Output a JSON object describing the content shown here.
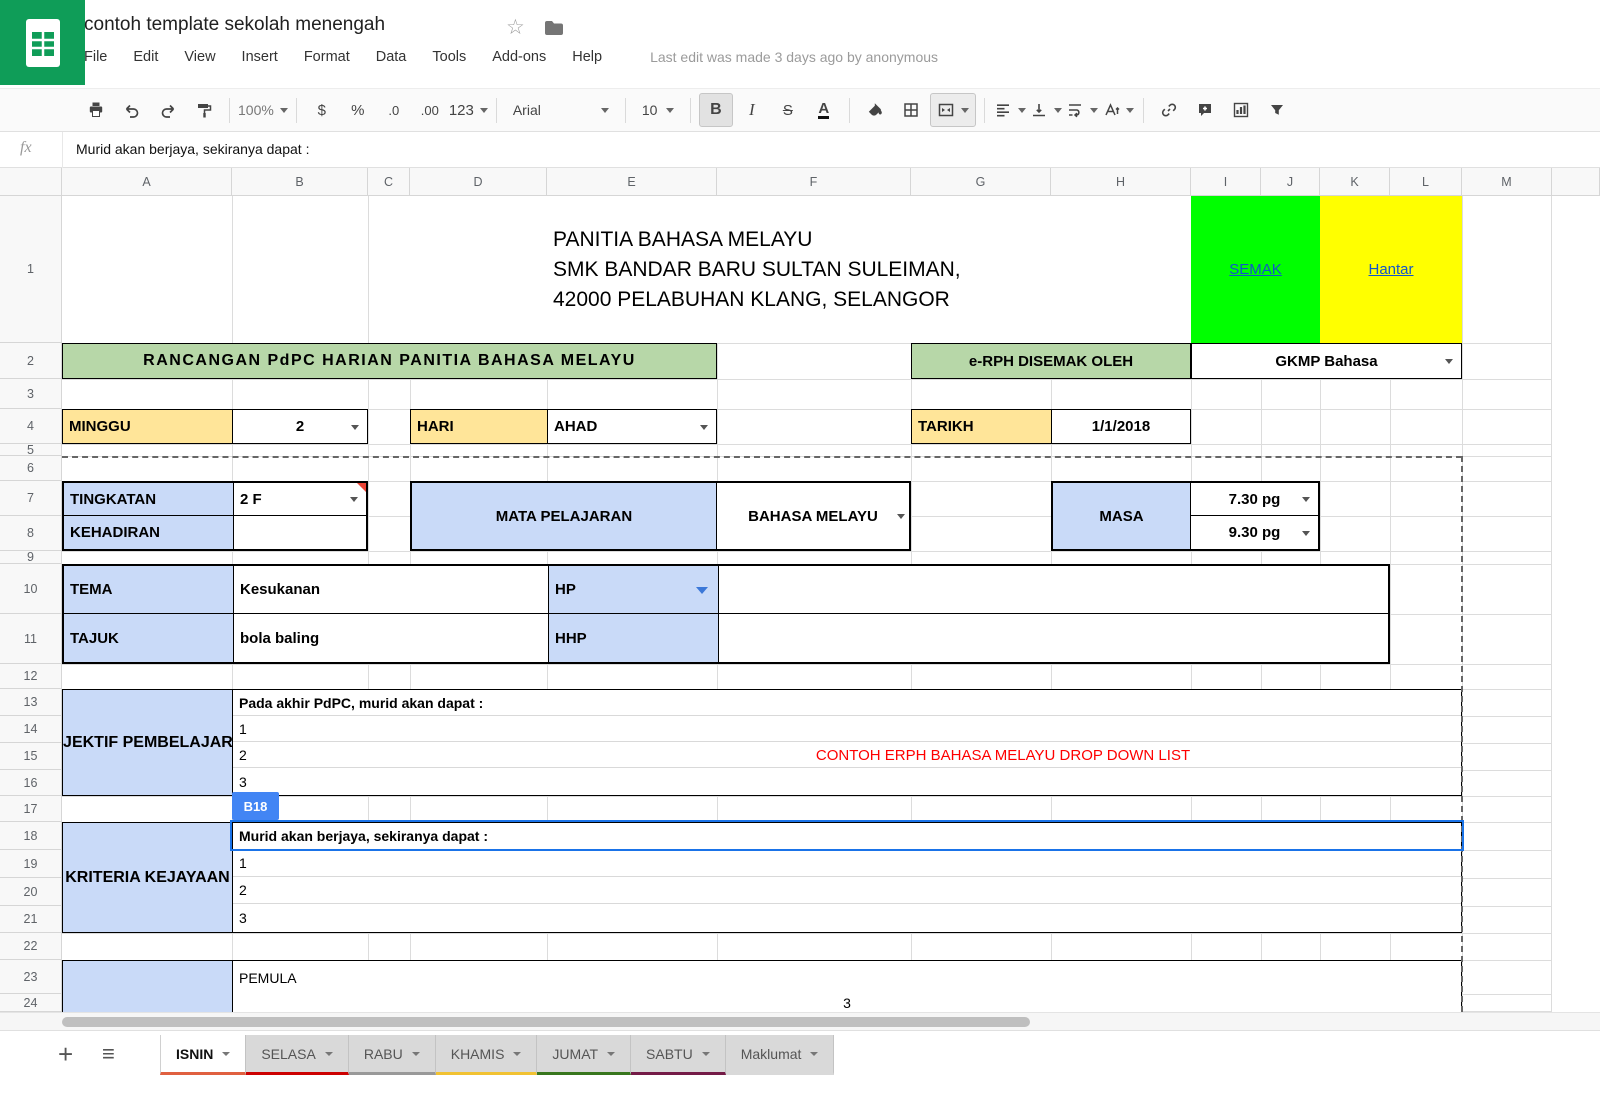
{
  "colors": {
    "logo-green": "#0f9d58",
    "green-fill": "#b7d7a8",
    "blue-fill": "#c9daf8",
    "orange-fill": "#ffe599",
    "semak-bg": "#00ff00",
    "hantar-bg": "#ffff00",
    "link-blue": "#1155cc",
    "selection-blue": "#1a73e8",
    "badge-blue": "#4285f4",
    "note-red": "#ff0000"
  },
  "header": {
    "title": "contoh template sekolah menengah",
    "menus": [
      "File",
      "Edit",
      "View",
      "Insert",
      "Format",
      "Data",
      "Tools",
      "Add-ons",
      "Help"
    ],
    "last_edit": "Last edit was made 3 days ago by anonymous"
  },
  "toolbar": {
    "zoom": "100%",
    "currency": "$",
    "percent": "%",
    "decimal_decrease": ".0",
    "decimal_increase": ".00",
    "more_formats": "123",
    "font_family": "Arial",
    "font_size": "10",
    "bold": "B",
    "italic": "I",
    "strikethrough": "S",
    "text_color": "A"
  },
  "formula_bar": {
    "fx": "fx",
    "value": "Murid akan berjaya, sekiranya dapat :"
  },
  "grid": {
    "columns": [
      "A",
      "B",
      "C",
      "D",
      "E",
      "F",
      "G",
      "H",
      "I",
      "J",
      "K",
      "L",
      "M"
    ],
    "rows": [
      "1",
      "2",
      "3",
      "4",
      "5",
      "6",
      "7",
      "8",
      "9",
      "10",
      "11",
      "12",
      "13",
      "14",
      "15",
      "16",
      "17",
      "18",
      "19",
      "20",
      "21",
      "22",
      "23",
      "24"
    ],
    "selected_cell": "B18"
  },
  "cells": {
    "school_line1": "PANITIA BAHASA MELAYU",
    "school_line2": "SMK BANDAR BARU SULTAN SULEIMAN,",
    "school_line3": "42000 PELABUHAN KLANG, SELANGOR",
    "semak": "SEMAK",
    "hantar": "Hantar",
    "rancangan": "RANCANGAN PdPC HARIAN PANITIA BAHASA MELAYU",
    "erph": "e-RPH DISEMAK OLEH",
    "gkmp": "GKMP Bahasa",
    "minggu": "MINGGU",
    "minggu_value": "2",
    "hari": "HARI",
    "hari_value": "AHAD",
    "tarikh": "TARIKH",
    "tarikh_value": "1/1/2018",
    "tingkatan": "TINGKATAN",
    "tingkatan_value": "2 F",
    "kehadiran": "KEHADIRAN",
    "mata_pelajaran": "MATA PELAJARAN",
    "mata_pelajaran_value": "BAHASA MELAYU",
    "masa": "MASA",
    "masa_mula": "7.30 pg",
    "masa_tamat": "9.30 pg",
    "tema": "TEMA",
    "tema_value": "Kesukanan",
    "hp": "HP",
    "hhp": "HHP",
    "tajuk": "TAJUK",
    "tajuk_value": "bola baling",
    "objektif": "OBJEKTIF PEMBELAJARAN",
    "objektif_intro": "Pada akhir PdPC, murid akan dapat :",
    "item1": "1",
    "item2": "2",
    "item3": "3",
    "note": "CONTOH ERPH BAHASA MELAYU DROP DOWN LIST",
    "kriteria": "KRITERIA KEJAYAAN",
    "kriteria_intro": "Murid akan berjaya, sekiranya dapat :",
    "pemula": "PEMULA",
    "row24": "3"
  },
  "sheet_tabs": [
    {
      "label": "ISNIN",
      "color": "#e06040",
      "active": true
    },
    {
      "label": "SELASA",
      "color": "#cc0000",
      "active": false
    },
    {
      "label": "RABU",
      "color": "#999999",
      "active": false
    },
    {
      "label": "KHAMIS",
      "color": "#f1c232",
      "active": false
    },
    {
      "label": "JUMAT",
      "color": "#38761d",
      "active": false
    },
    {
      "label": "SABTU",
      "color": "#741b47",
      "active": false
    },
    {
      "label": "Maklumat",
      "color": "transparent",
      "active": false
    }
  ]
}
